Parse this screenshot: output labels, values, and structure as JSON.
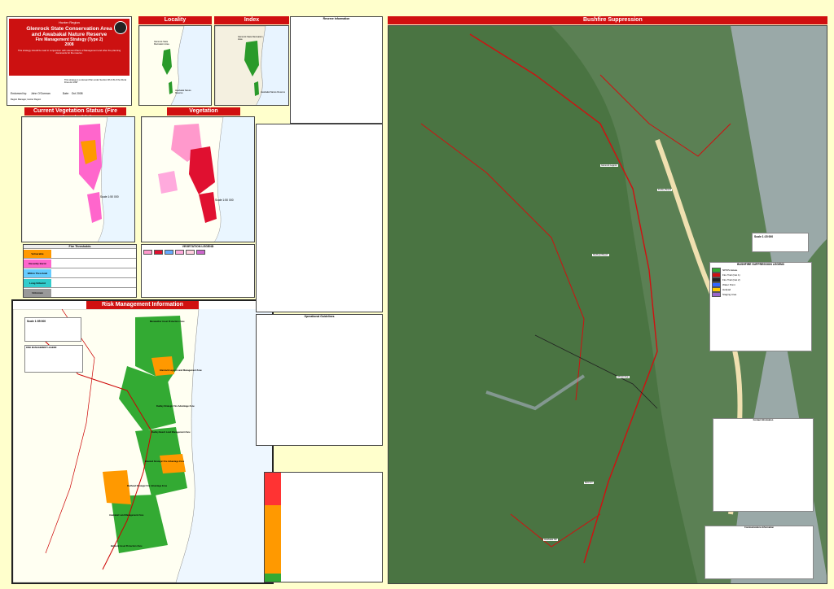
{
  "title_block": {
    "region": "Hunter Region",
    "park_name_1": "Glenrock State Conservation Area",
    "park_name_2": "and Awabakal Nature Reserve",
    "strategy": "Fire Management Strategy (Type 2)",
    "year": "2008",
    "notice": "This strategy should be read in conjunction with relevant Plans of Management and other fire planning documents for the reserve.",
    "approved_line": "This strategy is a relevant Plan under Section 38 & 39 of the Rural Fires Act 1997",
    "endorsed_label": "Endorsed by:",
    "endorsed_by": "John O'Gorman",
    "date_label": "Date:",
    "date": "Oct 2008",
    "role": "Region Manager, Hunter Region"
  },
  "locality": {
    "title": "Locality",
    "label_a": "Glenrock State Recreation Area",
    "label_b": "Awabakal Nature Reserve"
  },
  "index": {
    "title": "Index",
    "label_a": "Glenrock State Recreation Area",
    "label_b": "Awabakal Nature Reserve"
  },
  "vegetation_status": {
    "title": "Current Vegetation Status (Fire Thresholds)",
    "scale": "Scale 1:50 000"
  },
  "vegetation": {
    "title": "Vegetation",
    "scale": "Scale 1:50 000",
    "legend_title": "VEGETATION LEGEND"
  },
  "fire_thresholds": {
    "title": "Fire Thresholds",
    "rows": [
      {
        "name": "Vulnerable",
        "color": "#ff9900"
      },
      {
        "name": "Recently Burnt",
        "color": "#ff66cc"
      },
      {
        "name": "Within Threshold",
        "color": "#66ccff"
      },
      {
        "name": "Long Unburnt",
        "color": "#33cccc"
      },
      {
        "name": "Unknown",
        "color": "#999999"
      }
    ]
  },
  "risk": {
    "title": "Risk Management Information",
    "scale": "Scale 1:55 000",
    "legend_title": "RISK MANAGEMENT LEGEND",
    "zones": [
      "Merewether Asset Protection Zone",
      "Glenrock Lagoon Land Management Zone",
      "Dudley Strategic Fire Advantage Zone",
      "Dudley Beach Land Management Zone",
      "Bluebell Strategic Fire Advantage Zone",
      "Redhead Strategic Fire Advantage Zone",
      "Awabakal Land Management Zone",
      "Belmont Asset Protection Zone"
    ]
  },
  "bushfire": {
    "title": "Bushfire Suppression",
    "scale": "Scale 1:15 000",
    "legend_title": "BUSHFIRE SUPPRESSION LEGEND",
    "place_labels": [
      "Glenrock Lagoon",
      "Dudley Beach",
      "Redhead Beach",
      "Awabakal NR",
      "Whitebridge",
      "Belmont"
    ],
    "legend_items": [
      "NPWS Estate",
      "Fire Trail (Cat 1)",
      "Fire Trail (Cat 2)",
      "Water Point",
      "Helipad",
      "Staging Area"
    ]
  },
  "info_tables": {
    "reserve_title": "Reserve Information",
    "operational_title": "Operational Guidelines",
    "contacts_title": "Contact Information",
    "comms_title": "Communications Information"
  },
  "colors": {
    "banner": "#d01010",
    "park_green": "#33aa33",
    "orange_zone": "#ff9900",
    "trail": "#cc0000"
  }
}
